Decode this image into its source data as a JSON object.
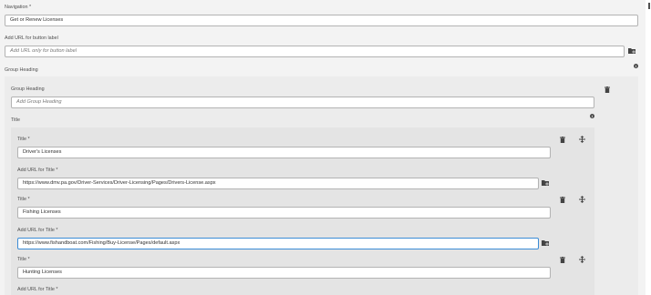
{
  "navigation": {
    "label": "Navigation *",
    "value": "Get or Renew Licenses"
  },
  "button_url": {
    "label": "Add URL for button label",
    "placeholder": "Add URL only for button label"
  },
  "group_heading": {
    "section_label": "Group Heading",
    "field_label": "Group Heading",
    "placeholder": "Add Group Heading"
  },
  "title_section": {
    "label": "Title",
    "items": [
      {
        "title_label": "Title *",
        "title_value": "Driver's Licenses",
        "url_label": "Add URL for Title *",
        "url_value": "https://www.dmv.pa.gov/Driver-Services/Driver-Licensing/Pages/Drivers-License.aspx"
      },
      {
        "title_label": "Title *",
        "title_value": "Fishing Licenses",
        "url_label": "Add URL for Title *",
        "url_value": "https://www.fishandboat.com/Fishing/Buy-License/Pages/default.aspx"
      },
      {
        "title_label": "Title *",
        "title_value": "Hunting Licenses",
        "url_label": "Add URL for Title *",
        "url_value": ""
      }
    ]
  },
  "icons": {
    "delete": "trash-icon",
    "reorder": "drag-handle-icon",
    "browse": "folder-search-icon",
    "info": "info-icon"
  },
  "colors": {
    "focus_border": "#3b8cd6",
    "field_border": "#b3b3b3"
  }
}
